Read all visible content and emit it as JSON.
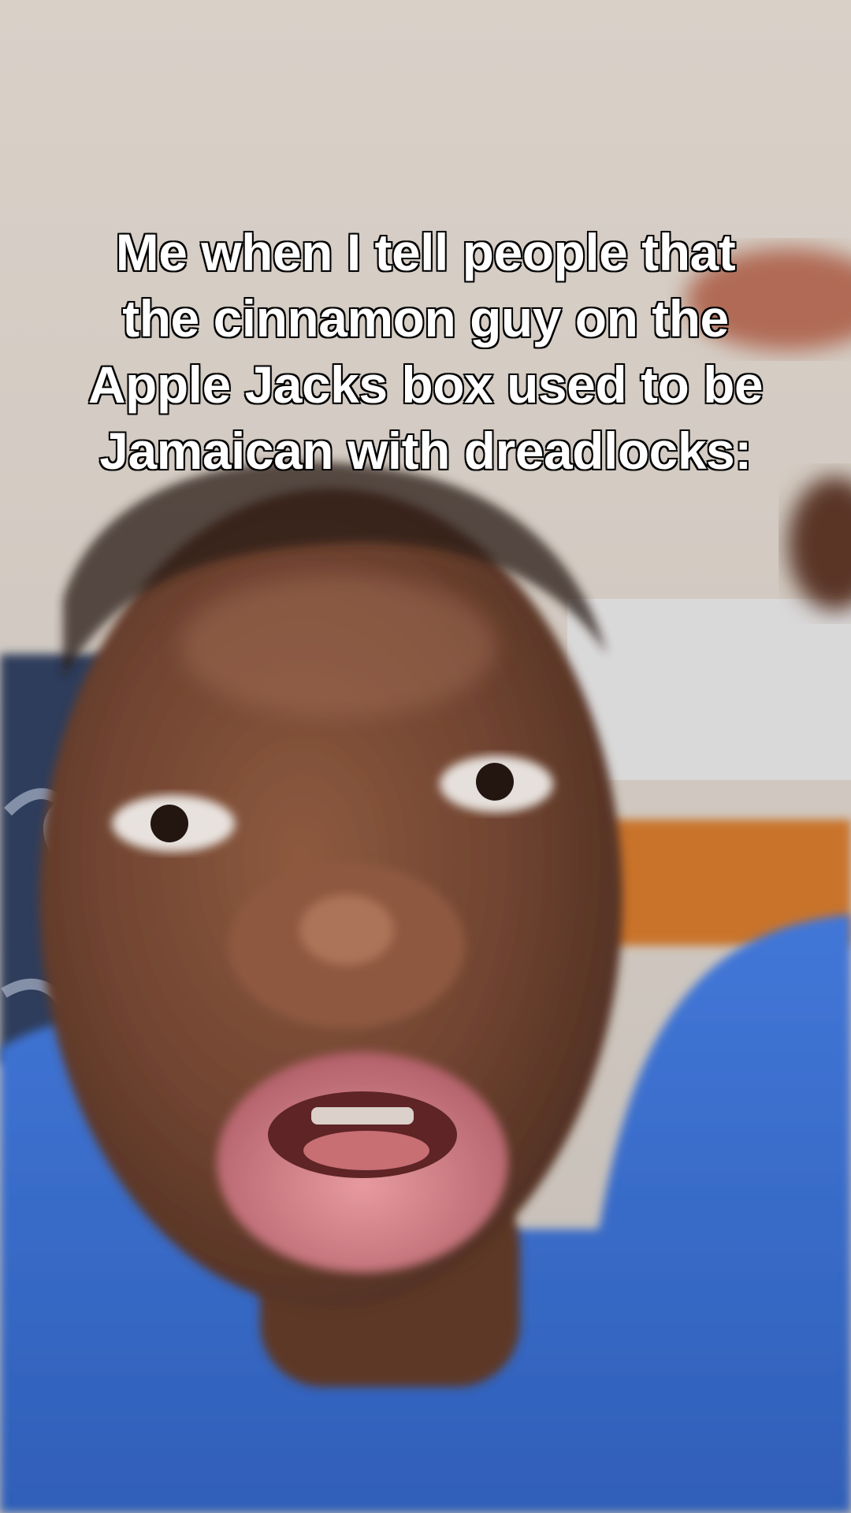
{
  "video": {
    "caption_lines": [
      "Me when I tell people that",
      "the cinnamon guy on the",
      "Apple Jacks box used to be",
      "Jamaican with dreadlocks:"
    ]
  },
  "colors": {
    "wall": "#d4cbc1",
    "wall_shadow": "#b9b2ab",
    "cabinet": "#c9732b",
    "shirt": "#3b6fd0",
    "skin": "#7a4a33",
    "lips": "#d98a8c"
  }
}
